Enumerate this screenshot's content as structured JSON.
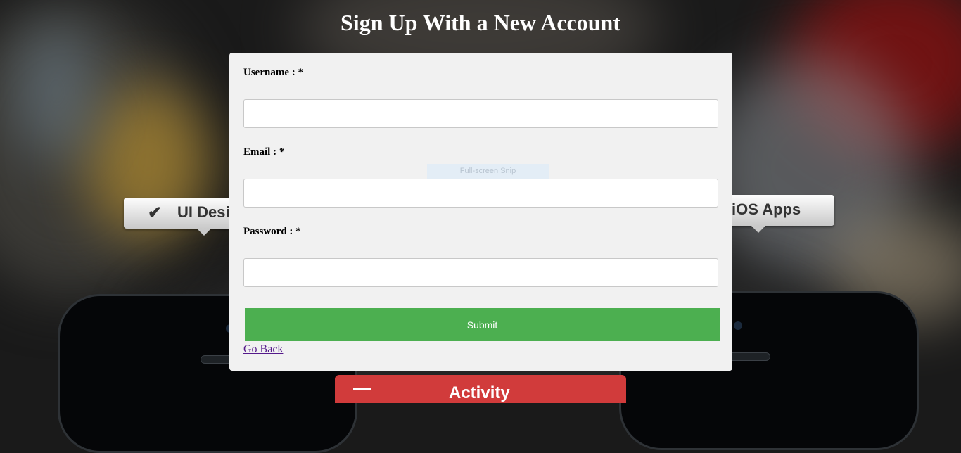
{
  "page": {
    "title": "Sign Up With a New Account"
  },
  "background": {
    "bubble_left_label": "UI Desi",
    "bubble_right_label": "iOS Apps",
    "activity_label": "Activity"
  },
  "form": {
    "username_label": "Username : *",
    "username_value": "",
    "email_label": "Email : *",
    "email_value": "",
    "password_label": "Password : *",
    "password_value": "",
    "submit_label": "Submit",
    "go_back_label": "Go Back"
  },
  "overlay": {
    "snip_label": "Full-screen Snip"
  },
  "colors": {
    "submit_bg": "#4caf50",
    "card_bg": "#f1f1f1",
    "link": "#551a8b",
    "activity_bar": "#d13b3b"
  }
}
